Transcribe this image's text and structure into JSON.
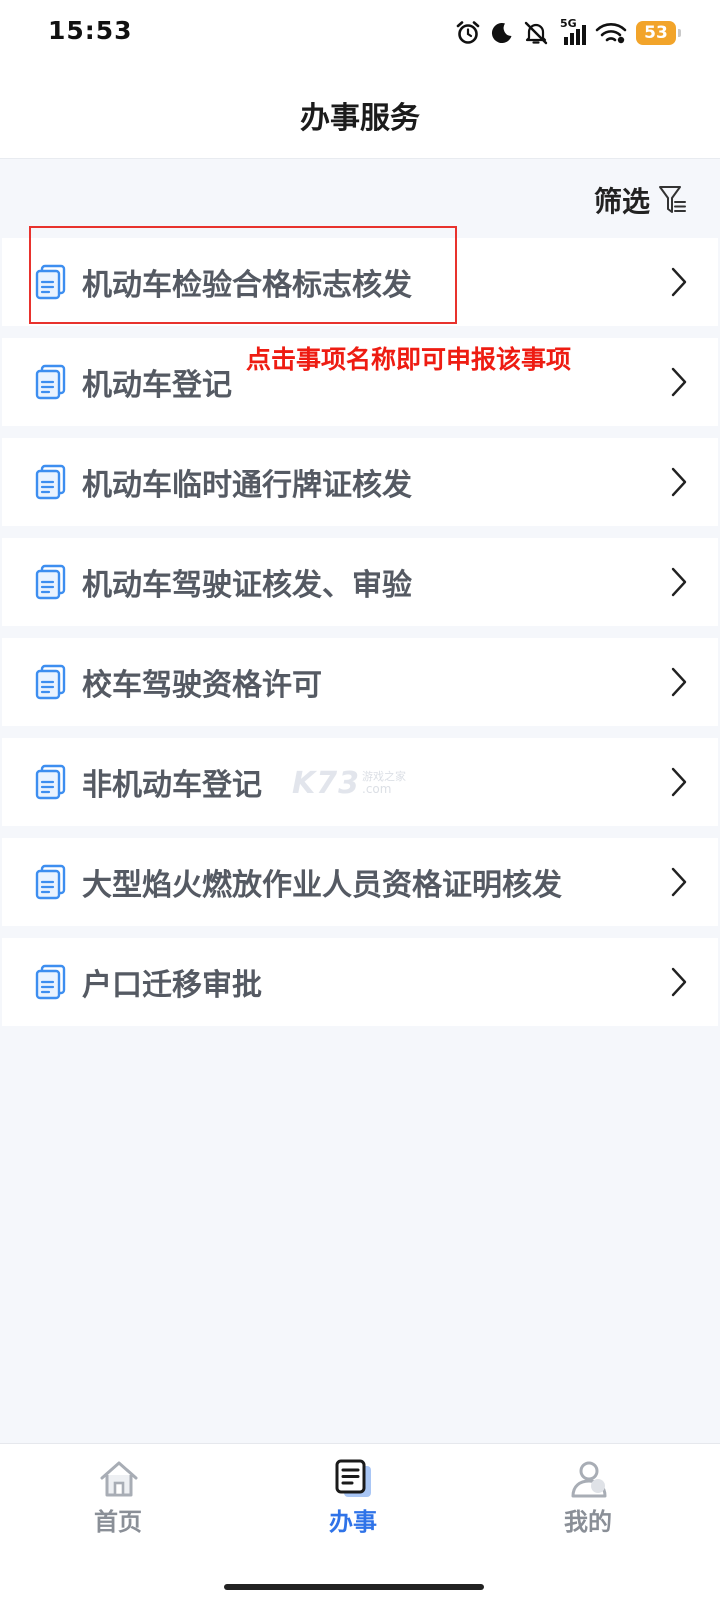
{
  "status_bar": {
    "time": "15:53",
    "network": "5G",
    "battery": "53",
    "icons": [
      "alarm-icon",
      "moon-icon",
      "mute-bell-icon",
      "signal-icon",
      "wifi-icon",
      "battery-icon"
    ],
    "battery_color": "#f2a42a"
  },
  "header": {
    "title": "办事服务"
  },
  "filter": {
    "label": "筛选",
    "icon": "filter-icon"
  },
  "services": [
    {
      "label": "机动车检验合格标志核发"
    },
    {
      "label": "机动车登记"
    },
    {
      "label": "机动车临时通行牌证核发"
    },
    {
      "label": "机动车驾驶证核发、审验"
    },
    {
      "label": "校车驾驶资格许可"
    },
    {
      "label": "非机动车登记"
    },
    {
      "label": "大型焰火燃放作业人员资格证明核发"
    },
    {
      "label": "户口迁移审批"
    }
  ],
  "annotation": {
    "text": "点击事项名称即可申报该事项",
    "color": "#ee1c12"
  },
  "watermark": {
    "brand": "K73",
    "tagline": "游戏之家",
    "domain": ".com"
  },
  "bottom_nav": {
    "items": [
      {
        "label": "首页",
        "icon": "home-icon",
        "active": false
      },
      {
        "label": "办事",
        "icon": "document-icon",
        "active": true
      },
      {
        "label": "我的",
        "icon": "user-icon",
        "active": false
      }
    ],
    "active_color": "#2f73e8"
  },
  "colors": {
    "accent": "#2f73e8",
    "icon_blue": "#3d8ef0",
    "background": "#f5f7fb"
  }
}
